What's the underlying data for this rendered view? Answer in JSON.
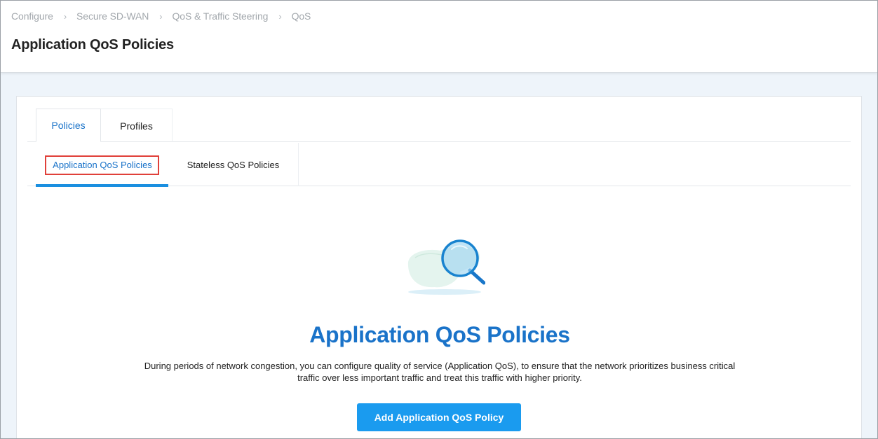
{
  "breadcrumb": [
    "Configure",
    "Secure SD-WAN",
    "QoS & Traffic Steering",
    "QoS"
  ],
  "breadcrumb_separator": "›",
  "page_title": "Application QoS Policies",
  "tabs": [
    {
      "label": "Policies",
      "active": true
    },
    {
      "label": "Profiles",
      "active": false
    }
  ],
  "subtabs": [
    {
      "label": "Application QoS Policies",
      "active": true
    },
    {
      "label": "Stateless QoS Policies",
      "active": false
    }
  ],
  "empty_state": {
    "icon": "magnifier-search-icon",
    "title": "Application QoS Policies",
    "description": "During periods of network congestion, you can configure quality of service (Application QoS), to ensure that the network prioritizes business critical traffic over less important traffic and treat this traffic with higher priority.",
    "button_label": "Add Application QoS Policy"
  },
  "colors": {
    "accent": "#1a73c9",
    "button": "#1a9bef",
    "highlight_box": "#e0403a"
  }
}
